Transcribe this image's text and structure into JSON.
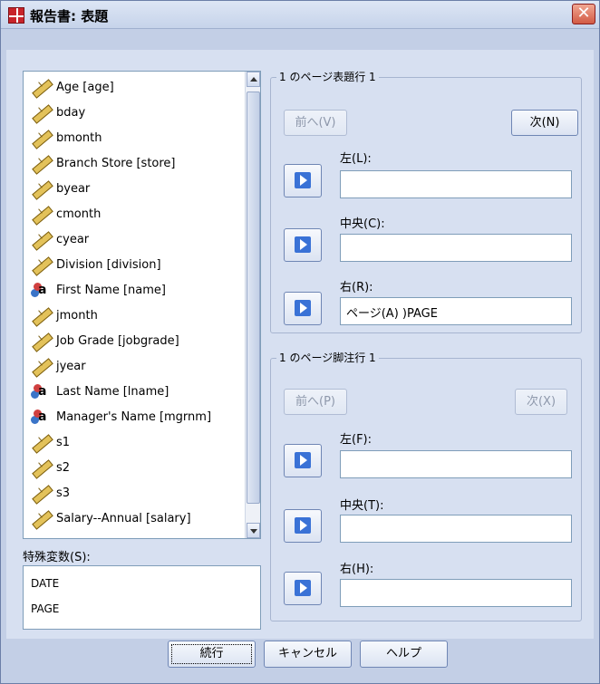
{
  "window": {
    "title": "報告書: 表題",
    "close_glyph": "✕"
  },
  "variables": [
    {
      "label": "Age [age]",
      "icon": "ruler-icon"
    },
    {
      "label": "bday",
      "icon": "ruler-icon"
    },
    {
      "label": "bmonth",
      "icon": "ruler-icon"
    },
    {
      "label": "Branch Store [store]",
      "icon": "ruler-icon"
    },
    {
      "label": "byear",
      "icon": "ruler-icon"
    },
    {
      "label": "cmonth",
      "icon": "ruler-icon"
    },
    {
      "label": "cyear",
      "icon": "ruler-icon"
    },
    {
      "label": "Division [division]",
      "icon": "ruler-icon"
    },
    {
      "label": "First Name [name]",
      "icon": "nominal-icon"
    },
    {
      "label": "jmonth",
      "icon": "ruler-icon"
    },
    {
      "label": "Job Grade [jobgrade]",
      "icon": "ruler-icon"
    },
    {
      "label": "jyear",
      "icon": "ruler-icon"
    },
    {
      "label": "Last Name [lname]",
      "icon": "nominal-icon"
    },
    {
      "label": "Manager's Name [mgrnm]",
      "icon": "nominal-icon"
    },
    {
      "label": "s1",
      "icon": "ruler-icon"
    },
    {
      "label": "s2",
      "icon": "ruler-icon"
    },
    {
      "label": "s3",
      "icon": "ruler-icon"
    },
    {
      "label": "Salary--Annual [salary]",
      "icon": "ruler-icon"
    }
  ],
  "special": {
    "label": "特殊変数(S):",
    "items": [
      "DATE",
      "PAGE"
    ]
  },
  "title_group": {
    "title": "1 のページ表題行 1",
    "prev_label": "前へ(V)",
    "next_label": "次(N)",
    "left_label": "左(L):",
    "left_value": "",
    "center_label": "中央(C):",
    "center_value": "",
    "right_label": "右(R):",
    "right_value": "ページ(A) )PAGE"
  },
  "footer_group": {
    "title": "1 のページ脚注行 1",
    "prev_label": "前へ(P)",
    "next_label": "次(X)",
    "left_label": "左(F):",
    "left_value": "",
    "center_label": "中央(T):",
    "center_value": "",
    "right_label": "右(H):",
    "right_value": ""
  },
  "buttons": {
    "continue": "続行",
    "cancel": "キャンセル",
    "help": "ヘルプ"
  }
}
